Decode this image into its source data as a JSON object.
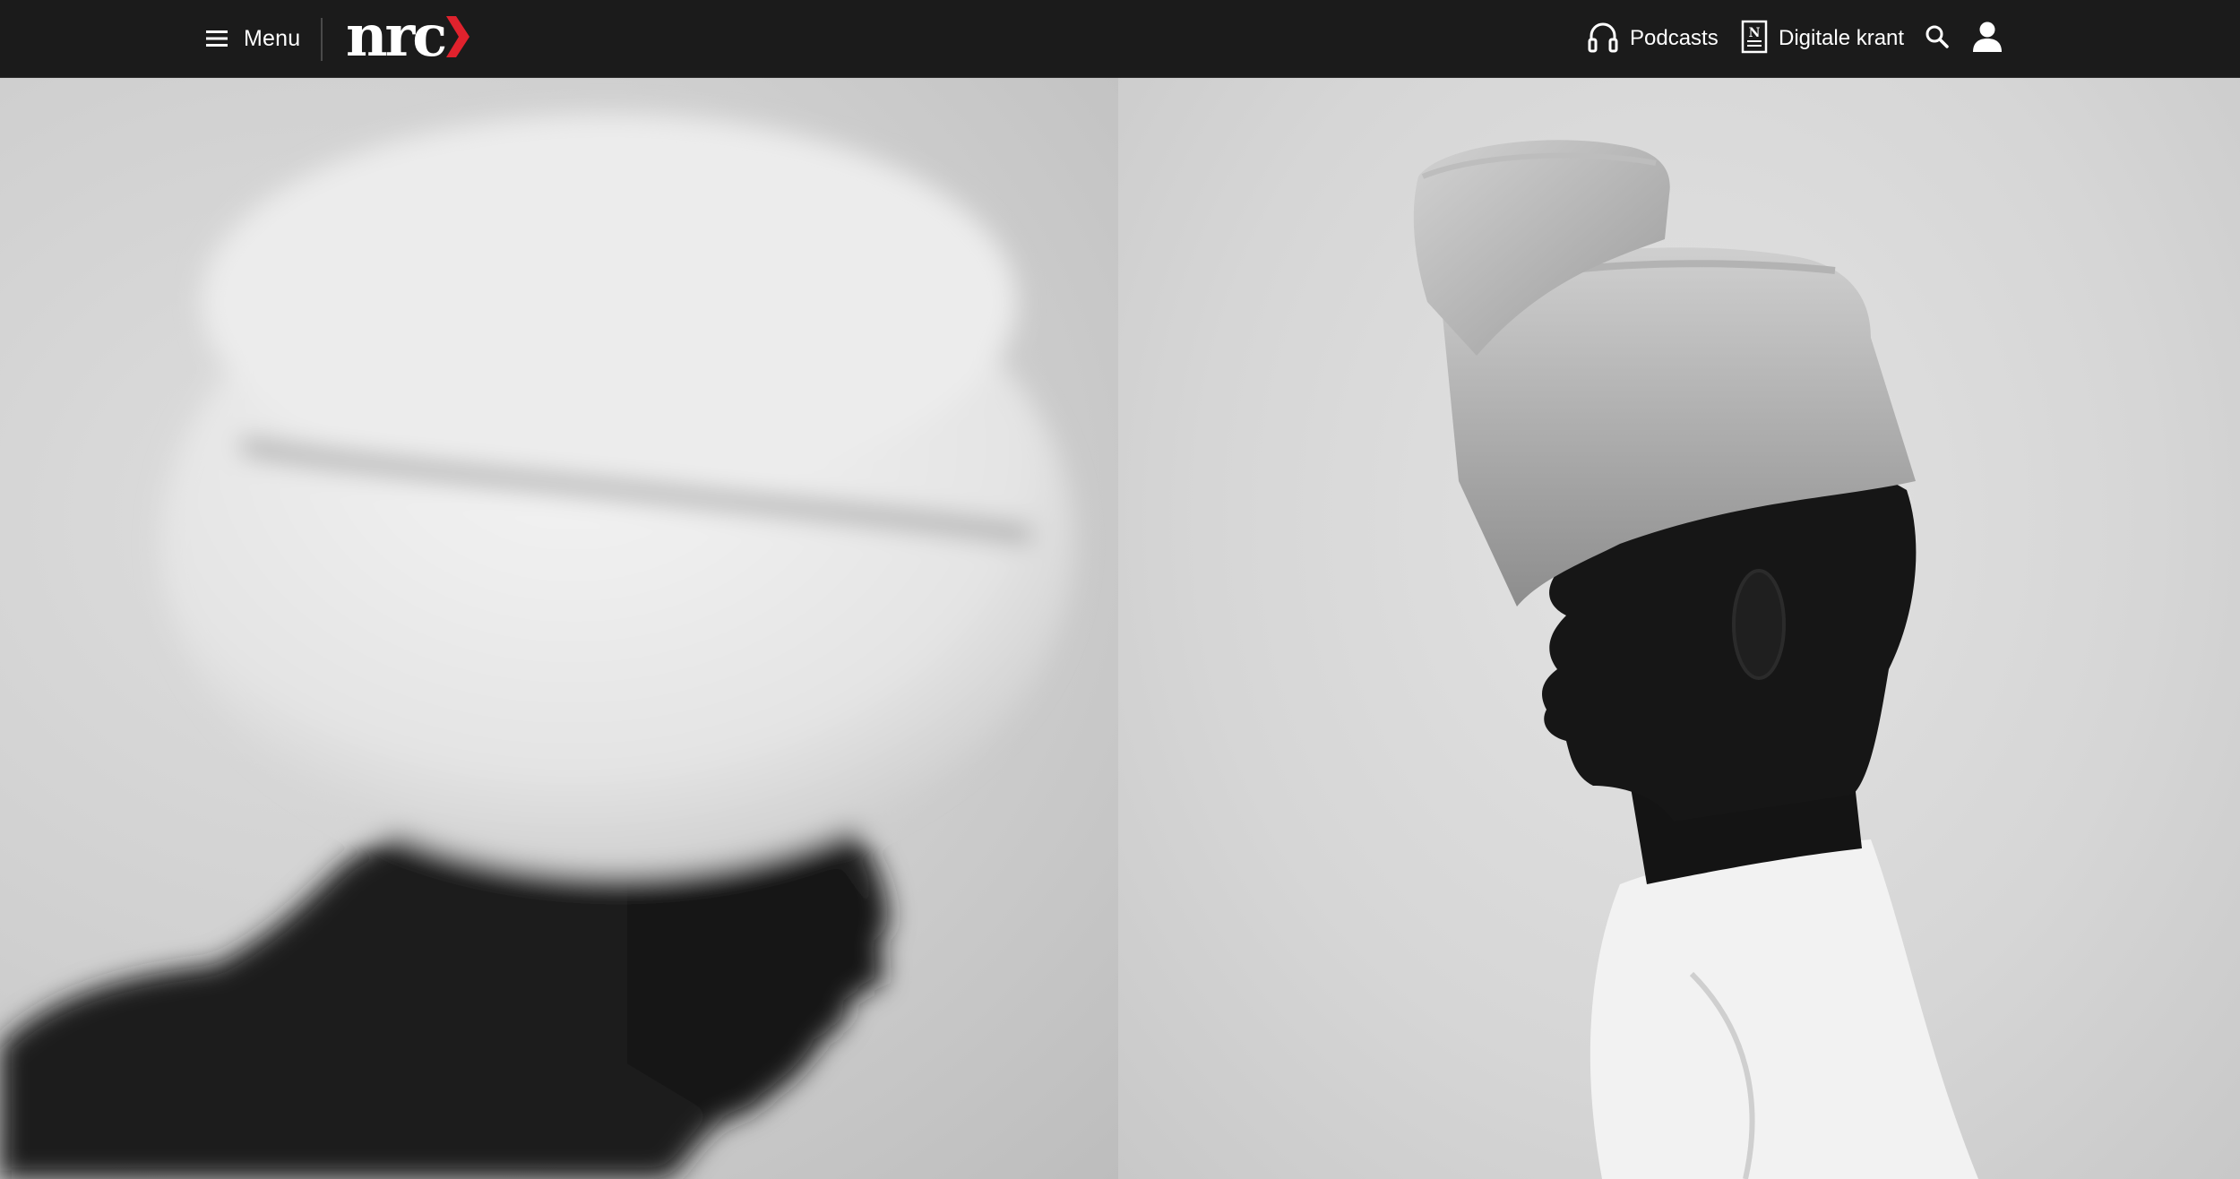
{
  "header": {
    "menu_label": "Menu",
    "logo_text": "nrc",
    "podcasts_label": "Podcasts",
    "krant_label": "Digitale krant",
    "krant_icon_letter": "N"
  },
  "icons": {
    "menu": "hamburger-icon",
    "podcasts": "headphones-icon",
    "krant": "newspaper-icon",
    "search": "search-icon",
    "account": "user-icon",
    "logo_chevron": "chevron-right-icon"
  },
  "colors": {
    "header_bg": "#1b1b1b",
    "logo_accent": "#e0222d",
    "text": "#ffffff"
  },
  "hero": {
    "left_photo": "blurred-profile-with-white-hat",
    "right_photo": "profile-with-stacked-felt-hat"
  }
}
